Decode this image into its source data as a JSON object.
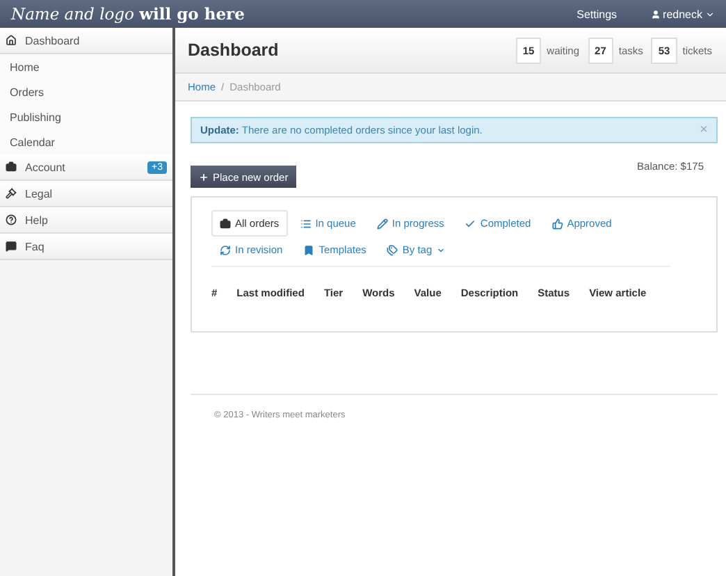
{
  "topbar": {
    "logo": "*Name and logo* **will go here**",
    "settings": "Settings",
    "user": "redneck"
  },
  "sidebar": {
    "items": [
      {
        "label": "Dashboard",
        "children": [
          {
            "label": "Home"
          },
          {
            "label": "Orders"
          },
          {
            "label": "Publishing"
          },
          {
            "label": "Calendar"
          }
        ]
      },
      {
        "label": "Account",
        "badge": "+3"
      },
      {
        "label": "Legal"
      },
      {
        "label": "Help"
      },
      {
        "label": "Faq"
      }
    ]
  },
  "header": {
    "title": "Dashboard",
    "stats": [
      {
        "count": "15",
        "label": "waiting"
      },
      {
        "count": "27",
        "label": "tasks"
      },
      {
        "count": "53",
        "label": "tickets"
      }
    ]
  },
  "breadcrumb": {
    "items": [
      "Home",
      "Dashboard"
    ],
    "separator": "/"
  },
  "alert": {
    "text": "**Update:** There are no completed orders since your last login.",
    "close": "×"
  },
  "new_order_button": "Place new order",
  "balance": "Balance: $175",
  "tabs": [
    {
      "label": "All orders",
      "selected": true
    },
    {
      "label": "In queue",
      "selected": false
    },
    {
      "label": "In progress",
      "selected": false
    },
    {
      "label": "Completed",
      "selected": false
    },
    {
      "label": "Approved",
      "selected": false
    },
    {
      "label": "In revision",
      "selected": false
    },
    {
      "label": "Templates",
      "selected": false
    },
    {
      "label": "By tag",
      "selected": false,
      "dropdown": true
    }
  ],
  "table": {
    "columns": [
      "#",
      "Last modified",
      "Tier",
      "Words",
      "Value",
      "Description",
      "Status",
      "View article"
    ]
  },
  "footer": "© 2013 - Writers meet marketers"
}
